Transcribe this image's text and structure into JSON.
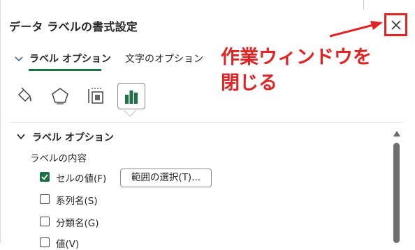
{
  "pane": {
    "title": "データ ラベルの書式設定",
    "close_icon": "close-icon"
  },
  "annotation": {
    "line1": "作業ウィンドウを",
    "line2": "閉じる",
    "color": "#e02424"
  },
  "tabs": [
    {
      "label": "ラベル オプション",
      "active": true
    },
    {
      "label": "文字のオプション",
      "active": false
    }
  ],
  "icon_tabs": [
    {
      "icon": "fill-bucket-icon",
      "selected": false
    },
    {
      "icon": "pentagon-icon",
      "selected": false
    },
    {
      "icon": "size-properties-icon",
      "selected": false
    },
    {
      "icon": "bar-chart-icon",
      "selected": true
    }
  ],
  "section": {
    "title": "ラベル オプション",
    "subtitle": "ラベルの内容",
    "options": [
      {
        "label": "セルの値(F)",
        "checked": true
      },
      {
        "label": "系列名(S)",
        "checked": false
      },
      {
        "label": "分類名(G)",
        "checked": false
      },
      {
        "label": "値(V)",
        "checked": false
      }
    ],
    "range_button": "範囲の選択(T)..."
  },
  "colors": {
    "accent": "#1e7145",
    "highlight": "#e02424"
  }
}
